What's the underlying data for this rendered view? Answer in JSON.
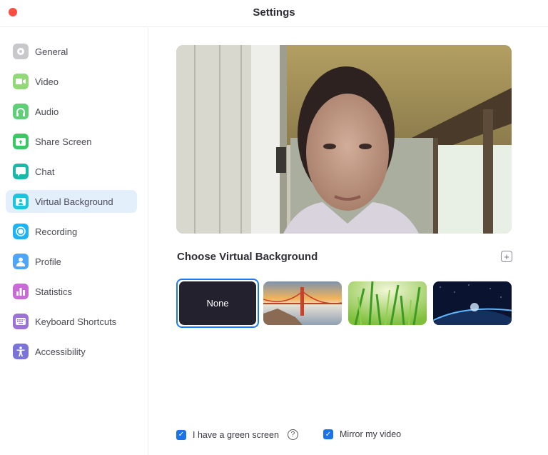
{
  "window": {
    "title": "Settings"
  },
  "sidebar": {
    "items": [
      {
        "label": "General",
        "icon": "gear-icon",
        "color": "#c8c8cc"
      },
      {
        "label": "Video",
        "icon": "video-camera-icon",
        "color": "#93d977"
      },
      {
        "label": "Audio",
        "icon": "headphones-icon",
        "color": "#5fcf78"
      },
      {
        "label": "Share Screen",
        "icon": "share-screen-icon",
        "color": "#3ac764"
      },
      {
        "label": "Chat",
        "icon": "chat-bubble-icon",
        "color": "#19b9a8"
      },
      {
        "label": "Virtual Background",
        "icon": "virtual-background-icon",
        "color": "#1cc5dc",
        "active": true
      },
      {
        "label": "Recording",
        "icon": "record-icon",
        "color": "#1eb3f2"
      },
      {
        "label": "Profile",
        "icon": "profile-icon",
        "color": "#4da6f8"
      },
      {
        "label": "Statistics",
        "icon": "bar-chart-icon",
        "color": "#c96bd6"
      },
      {
        "label": "Keyboard Shortcuts",
        "icon": "keyboard-icon",
        "color": "#9b72d8"
      },
      {
        "label": "Accessibility",
        "icon": "accessibility-icon",
        "color": "#7a73d8"
      }
    ]
  },
  "main": {
    "section_title": "Choose Virtual Background",
    "add_button": "+",
    "backgrounds": [
      {
        "label": "None",
        "selected": true
      },
      {
        "label": "Golden Gate Bridge"
      },
      {
        "label": "Grass"
      },
      {
        "label": "Earth from space"
      }
    ],
    "options": [
      {
        "label": "I have a green screen",
        "checked": true,
        "help": "?"
      },
      {
        "label": "Mirror my video",
        "checked": true
      }
    ],
    "check_glyph": "✓"
  },
  "colors": {
    "accent": "#1a73e8",
    "selected_bg": "#e4effc",
    "close": "#fb4e43"
  }
}
